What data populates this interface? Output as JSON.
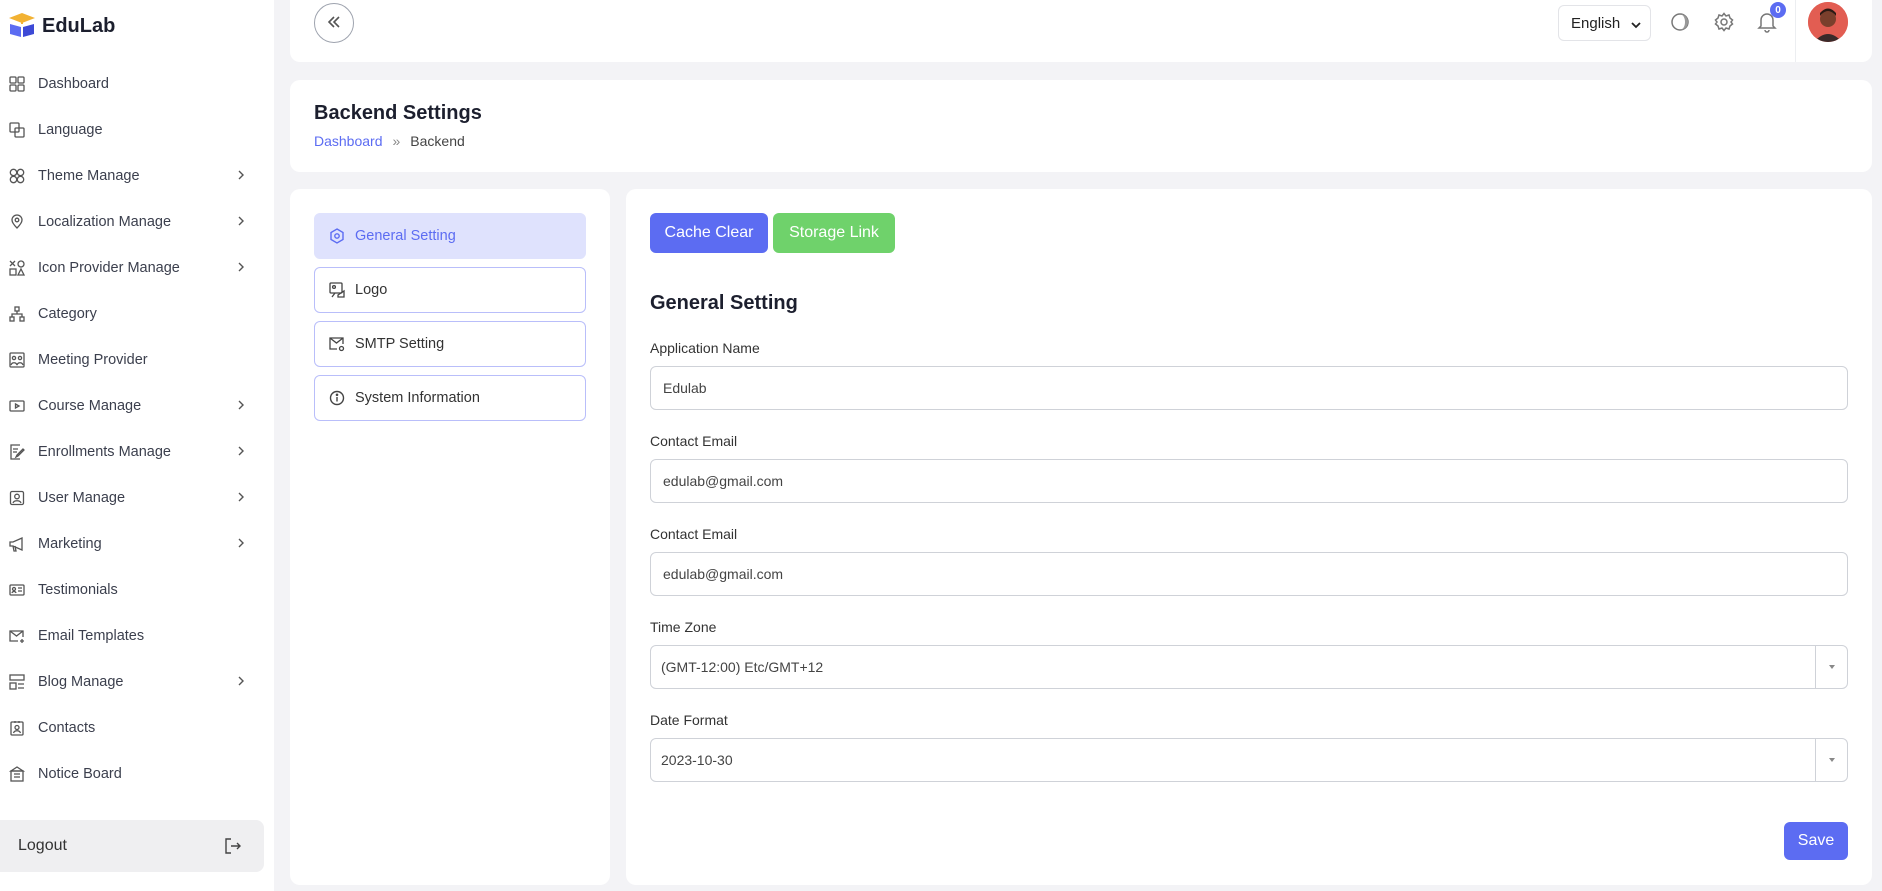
{
  "brand": {
    "name": "EduLab"
  },
  "sidebar": {
    "items": [
      {
        "label": "Dashboard",
        "icon": "dashboard-icon",
        "has_children": false
      },
      {
        "label": "Language",
        "icon": "language-icon",
        "has_children": false
      },
      {
        "label": "Theme Manage",
        "icon": "theme-icon",
        "has_children": true
      },
      {
        "label": "Localization Manage",
        "icon": "location-icon",
        "has_children": true
      },
      {
        "label": "Icon Provider Manage",
        "icon": "icon-provider-icon",
        "has_children": true
      },
      {
        "label": "Category",
        "icon": "category-icon",
        "has_children": false
      },
      {
        "label": "Meeting Provider",
        "icon": "meeting-icon",
        "has_children": false
      },
      {
        "label": "Course Manage",
        "icon": "course-icon",
        "has_children": true
      },
      {
        "label": "Enrollments Manage",
        "icon": "enrollment-icon",
        "has_children": true
      },
      {
        "label": "User Manage",
        "icon": "user-icon",
        "has_children": true
      },
      {
        "label": "Marketing",
        "icon": "megaphone-icon",
        "has_children": true
      },
      {
        "label": "Testimonials",
        "icon": "testimonial-icon",
        "has_children": false
      },
      {
        "label": "Email Templates",
        "icon": "email-icon",
        "has_children": false
      },
      {
        "label": "Blog Manage",
        "icon": "blog-icon",
        "has_children": true
      },
      {
        "label": "Contacts",
        "icon": "contacts-icon",
        "has_children": false
      },
      {
        "label": "Notice Board",
        "icon": "notice-icon",
        "has_children": false
      }
    ],
    "logout_label": "Logout"
  },
  "topbar": {
    "language": "English",
    "notification_count": "0"
  },
  "page": {
    "title": "Backend Settings",
    "breadcrumb": {
      "home": "Dashboard",
      "separator": "»",
      "current": "Backend"
    }
  },
  "settings_menu": {
    "items": [
      {
        "label": "General Setting",
        "active": true
      },
      {
        "label": "Logo",
        "active": false
      },
      {
        "label": "SMTP Setting",
        "active": false
      },
      {
        "label": "System Information",
        "active": false
      }
    ]
  },
  "form": {
    "cache_clear_label": "Cache Clear",
    "storage_link_label": "Storage Link",
    "section_title": "General Setting",
    "app_name_label": "Application Name",
    "app_name_value": "Edulab",
    "contact_email_label": "Contact Email",
    "contact_email_value": "edulab@gmail.com",
    "contact_email2_label": "Contact Email",
    "contact_email2_value": "edulab@gmail.com",
    "timezone_label": "Time Zone",
    "timezone_value": "(GMT-12:00) Etc/GMT+12",
    "date_format_label": "Date Format",
    "date_format_value": "2023-10-30",
    "save_label": "Save"
  },
  "colors": {
    "primary": "#5c6cf2",
    "success": "#6fd26b",
    "active_menu_bg": "#dfe2fd"
  }
}
